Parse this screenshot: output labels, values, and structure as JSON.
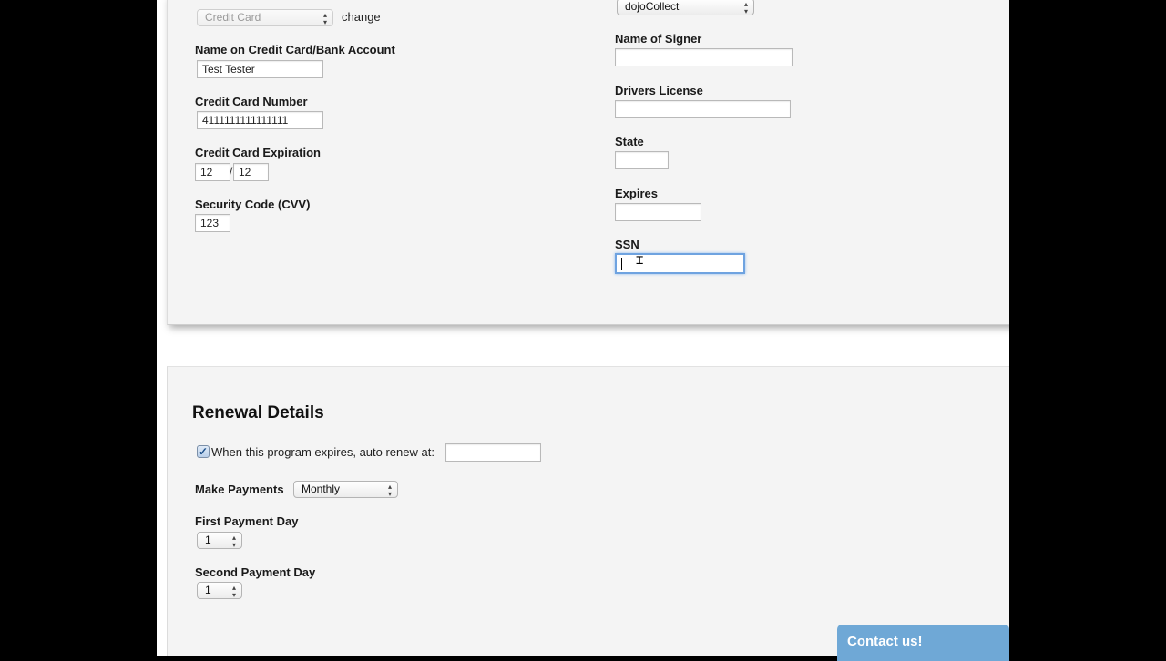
{
  "payment": {
    "method_select": "Credit Card",
    "change_link": "change",
    "collector_select": "dojoCollect",
    "name_label": "Name on Credit Card/Bank Account",
    "name_value": "Test Tester",
    "card_number_label": "Credit Card Number",
    "card_number_value": "4111111111111111",
    "expiration_label": "Credit Card Expiration",
    "exp_month": "12",
    "exp_separator": "/",
    "exp_year": "12",
    "cvv_label": "Security Code (CVV)",
    "cvv_value": "123",
    "signer_label": "Name of Signer",
    "signer_value": "",
    "license_label": "Drivers License",
    "license_value": "",
    "state_label": "State",
    "state_value": "",
    "expires_label": "Expires",
    "expires_value": "",
    "ssn_label": "SSN",
    "ssn_value": ""
  },
  "renewal": {
    "title": "Renewal Details",
    "auto_renew_label": "When this program expires, auto renew at:",
    "auto_renew_checked": true,
    "auto_renew_value": "",
    "make_payments_label": "Make Payments",
    "make_payments_value": "Monthly",
    "first_day_label": "First Payment Day",
    "first_day_value": "1",
    "second_day_label": "Second Payment Day",
    "second_day_value": "1"
  },
  "contact": {
    "label": "Contact us!"
  },
  "colors": {
    "accent": "#6fa8d6",
    "focus": "#6fa3e0"
  }
}
